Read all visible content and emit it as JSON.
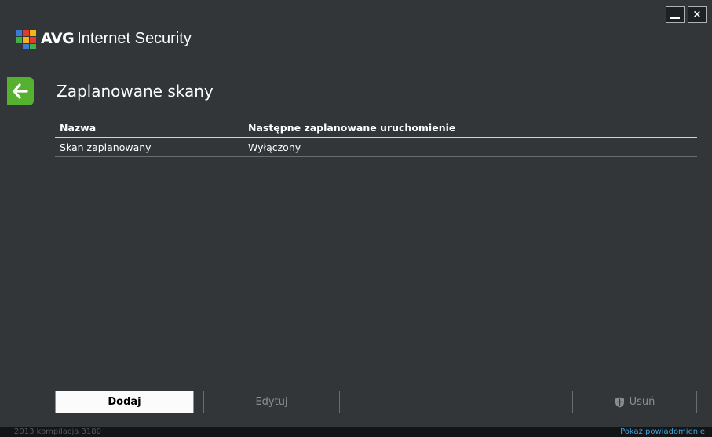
{
  "window": {
    "brand_avg": "AVG",
    "brand_rest": "Internet Security",
    "minimize_icon": "minimize-icon",
    "close_icon": "close-icon",
    "close_glyph": "×"
  },
  "page": {
    "title": "Zaplanowane skany",
    "back_icon": "arrow-left-icon"
  },
  "table": {
    "columns": [
      "Nazwa",
      "Następne zaplanowane uruchomienie"
    ],
    "rows": [
      [
        "Skan zaplanowany",
        "Wyłączony"
      ]
    ]
  },
  "buttons": {
    "add": "Dodaj",
    "edit": "Edytuj",
    "delete": "Usuń"
  },
  "footer": {
    "build": "2013  kompilacja 3180",
    "notifications": "Pokaż powiadomienie"
  },
  "colors": {
    "background": "#333639",
    "accent_green": "#57b131",
    "link_blue": "#43a4da"
  }
}
